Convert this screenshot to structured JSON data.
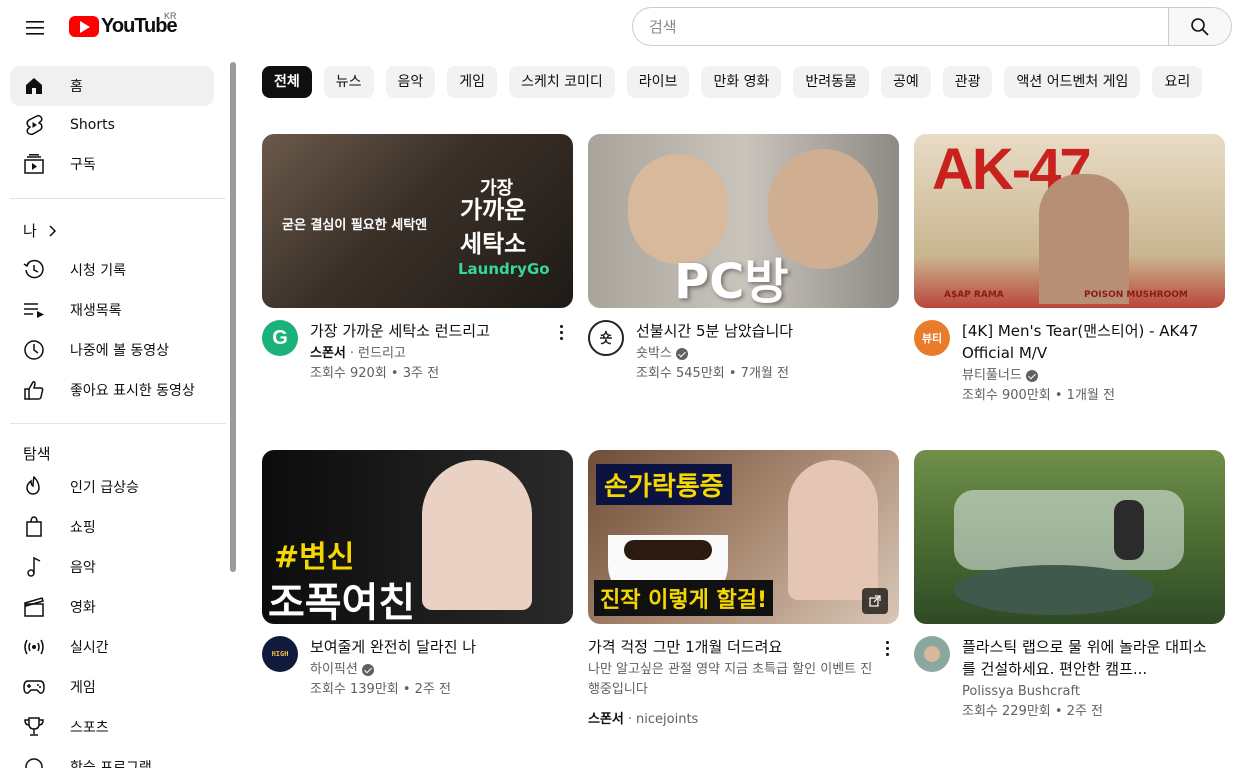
{
  "header": {
    "logo_text": "YouTube",
    "region": "KR",
    "search_placeholder": "검색"
  },
  "sidebar": {
    "main": [
      {
        "label": "홈",
        "icon": "home-icon",
        "active": true
      },
      {
        "label": "Shorts",
        "icon": "shorts-icon"
      },
      {
        "label": "구독",
        "icon": "subscriptions-icon"
      }
    ],
    "you_heading": "나",
    "you": [
      {
        "label": "시청 기록",
        "icon": "history-icon"
      },
      {
        "label": "재생목록",
        "icon": "playlist-icon"
      },
      {
        "label": "나중에 볼 동영상",
        "icon": "watch-later-icon"
      },
      {
        "label": "좋아요 표시한 동영상",
        "icon": "like-icon"
      }
    ],
    "explore_heading": "탐색",
    "explore": [
      {
        "label": "인기 급상승",
        "icon": "trending-icon"
      },
      {
        "label": "쇼핑",
        "icon": "shopping-icon"
      },
      {
        "label": "음악",
        "icon": "music-icon"
      },
      {
        "label": "영화",
        "icon": "movies-icon"
      },
      {
        "label": "실시간",
        "icon": "live-icon"
      },
      {
        "label": "게임",
        "icon": "gaming-icon"
      },
      {
        "label": "스포츠",
        "icon": "sports-icon"
      },
      {
        "label": "학습 프로그램",
        "icon": "learning-icon"
      }
    ]
  },
  "chips": [
    "전체",
    "뉴스",
    "음악",
    "게임",
    "스케치 코미디",
    "라이브",
    "만화 영화",
    "반려동물",
    "공예",
    "관광",
    "액션 어드벤처 게임",
    "요리"
  ],
  "videos": [
    {
      "title": "가장 가까운 세탁소 런드리고",
      "sponsor": "스폰서",
      "channel": "런드리고",
      "stats": "조회수 920회 • 3주 전",
      "thumb_text": [
        "굳은 결심이 필요한 세탁엔",
        "가장",
        "가까운",
        "세탁소",
        "LaundryGo"
      ]
    },
    {
      "title": "선불시간 5분 남았습니다",
      "channel": "숏박스",
      "stats": "조회수 545만회 • 7개월 전",
      "thumb_text": [
        "PC방"
      ]
    },
    {
      "title": "[4K] Men's Tear(맨스티어) - AK47 Official M/V",
      "channel": "뷰티풀너드",
      "stats": "조회수 900만회 • 1개월 전",
      "thumb_text": [
        "AK-47",
        "A$AP RAMA",
        "POISON MUSHROOM"
      ]
    },
    {
      "title": "보여줄게 완전히 달라진 나",
      "channel": "하이픽션",
      "stats": "조회수 139만회 • 2주 전",
      "thumb_text": [
        "#변신",
        "조폭여친"
      ]
    },
    {
      "title": "가격 걱정 그만 1개월 더드려요",
      "desc": "나만 알고싶은 관절 영약 지금 초특급 할인 이벤트 진행중입니다",
      "sponsor": "스폰서",
      "channel": "nicejoints",
      "thumb_text": [
        "손가락통증",
        "진작 이렇게 할걸!"
      ]
    },
    {
      "title": "플라스틱 랩으로 물 위에 놀라운 대피소를 건설하세요. 편안한 캠프...",
      "channel": "Polissya Bushcraft",
      "stats": "조회수 229만회 • 2주 전"
    }
  ],
  "colors": {
    "accent": "#ff0000",
    "chip_active": "#0f0f0f"
  }
}
